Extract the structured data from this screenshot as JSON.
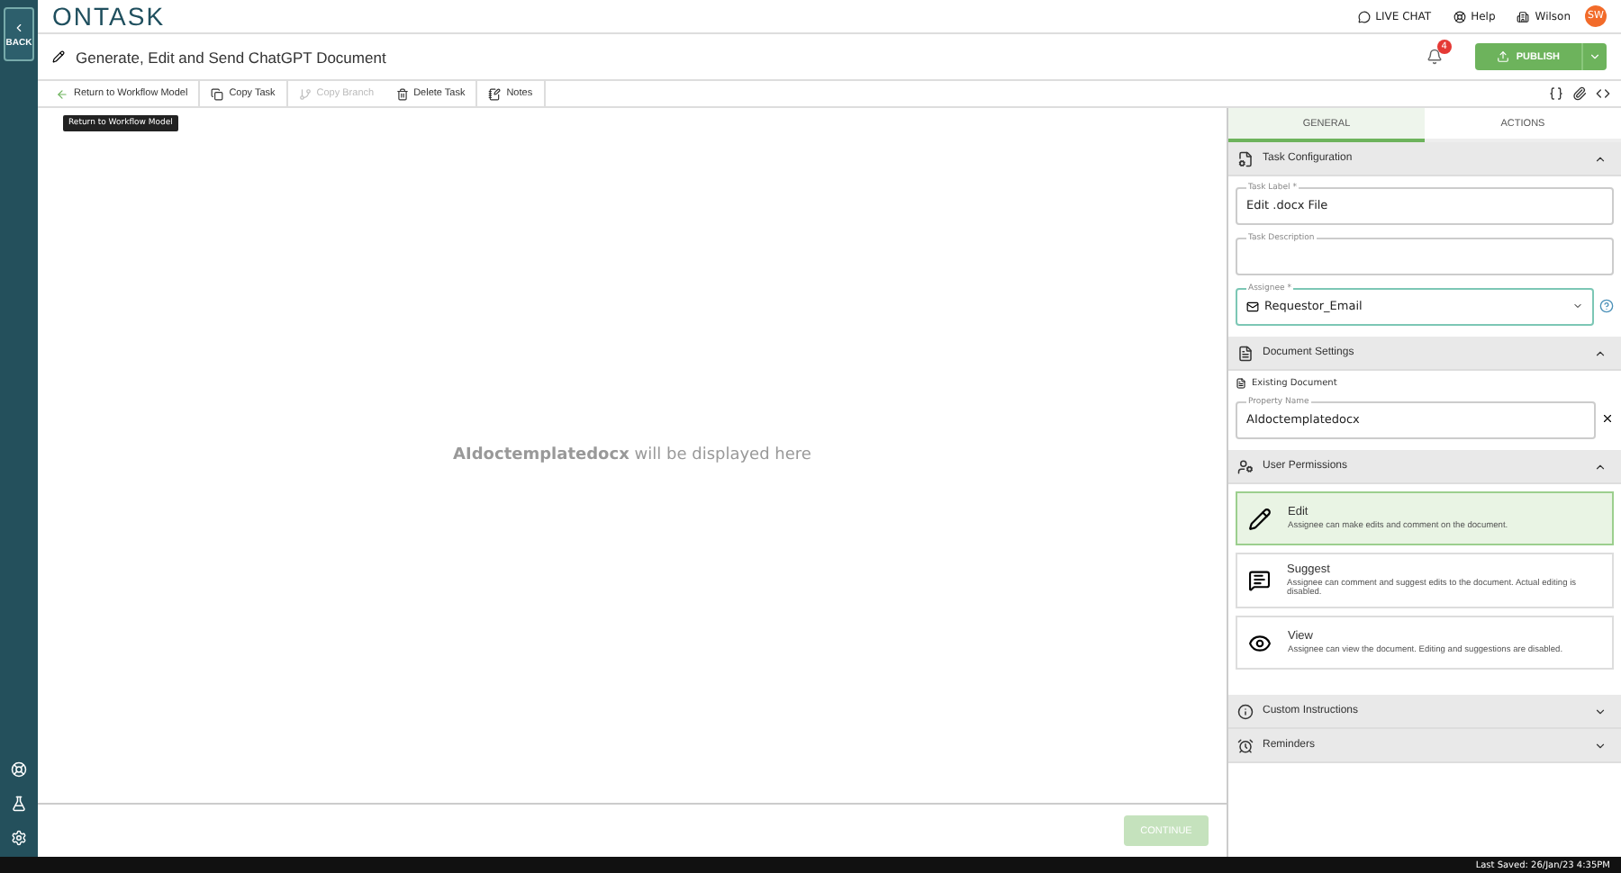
{
  "sidebar": {
    "back_label": "BACK"
  },
  "header": {
    "logo": "ONTASK",
    "links": [
      {
        "kind": "chat",
        "label": "LIVE CHAT"
      },
      {
        "kind": "help",
        "label": "Help"
      },
      {
        "kind": "org",
        "label": "Wilson"
      }
    ],
    "avatar": "SW"
  },
  "title_bar": {
    "title": "Generate, Edit and Send ChatGPT Document",
    "notification_count": "4",
    "publish": "PUBLISH"
  },
  "toolbar": {
    "items": [
      {
        "kind": "back",
        "label": "Return to Workflow Model",
        "disabled": false
      },
      {
        "kind": "copy",
        "label": "Copy Task",
        "disabled": false
      },
      {
        "kind": "branch",
        "label": "Copy Branch",
        "disabled": true
      },
      {
        "kind": "delete",
        "label": "Delete Task",
        "disabled": false
      },
      {
        "kind": "notes",
        "label": "Notes",
        "disabled": false
      }
    ],
    "tooltip": "Return to Workflow Model"
  },
  "canvas": {
    "doc_name": "AIdoctemplatedocx",
    "message": "will be displayed here",
    "continue": "CONTINUE",
    "continue_disabled": true
  },
  "panel": {
    "tabs": [
      {
        "label": "GENERAL",
        "selected": true
      },
      {
        "label": "ACTIONS",
        "selected": false
      }
    ],
    "sections": [
      {
        "kind": "config",
        "title": "Task Configuration",
        "expanded": true,
        "fields": [
          {
            "label": "Task Label *",
            "value": "Edit .docx File"
          },
          {
            "label": "Task Description"
          },
          {
            "label": "Assignee *",
            "value": "Requestor_Email",
            "focused": true
          }
        ]
      },
      {
        "kind": "document",
        "title": "Document Settings",
        "expanded": true,
        "option": "Existing Document",
        "field": {
          "label": "Property Name",
          "value": "AIdoctemplatedocx"
        }
      },
      {
        "kind": "permissions",
        "title": "User Permissions",
        "expanded": true,
        "options": [
          {
            "kind": "edit",
            "title": "Edit",
            "text": "Assignee can make edits and comment on the document.",
            "selected": true
          },
          {
            "kind": "suggest",
            "title": "Suggest",
            "text": "Assignee can comment and suggest edits to the document. Actual editing is disabled.",
            "selected": false
          },
          {
            "kind": "view",
            "title": "View",
            "text": "Assignee can view the document. Editing and suggestions are disabled.",
            "selected": false
          }
        ]
      },
      {
        "kind": "info",
        "title": "Custom Instructions",
        "expanded": false
      },
      {
        "kind": "alarm",
        "title": "Reminders",
        "expanded": false
      }
    ]
  },
  "status_bar": {
    "text": "Last Saved: 26/Jan/23 4:35PM"
  }
}
